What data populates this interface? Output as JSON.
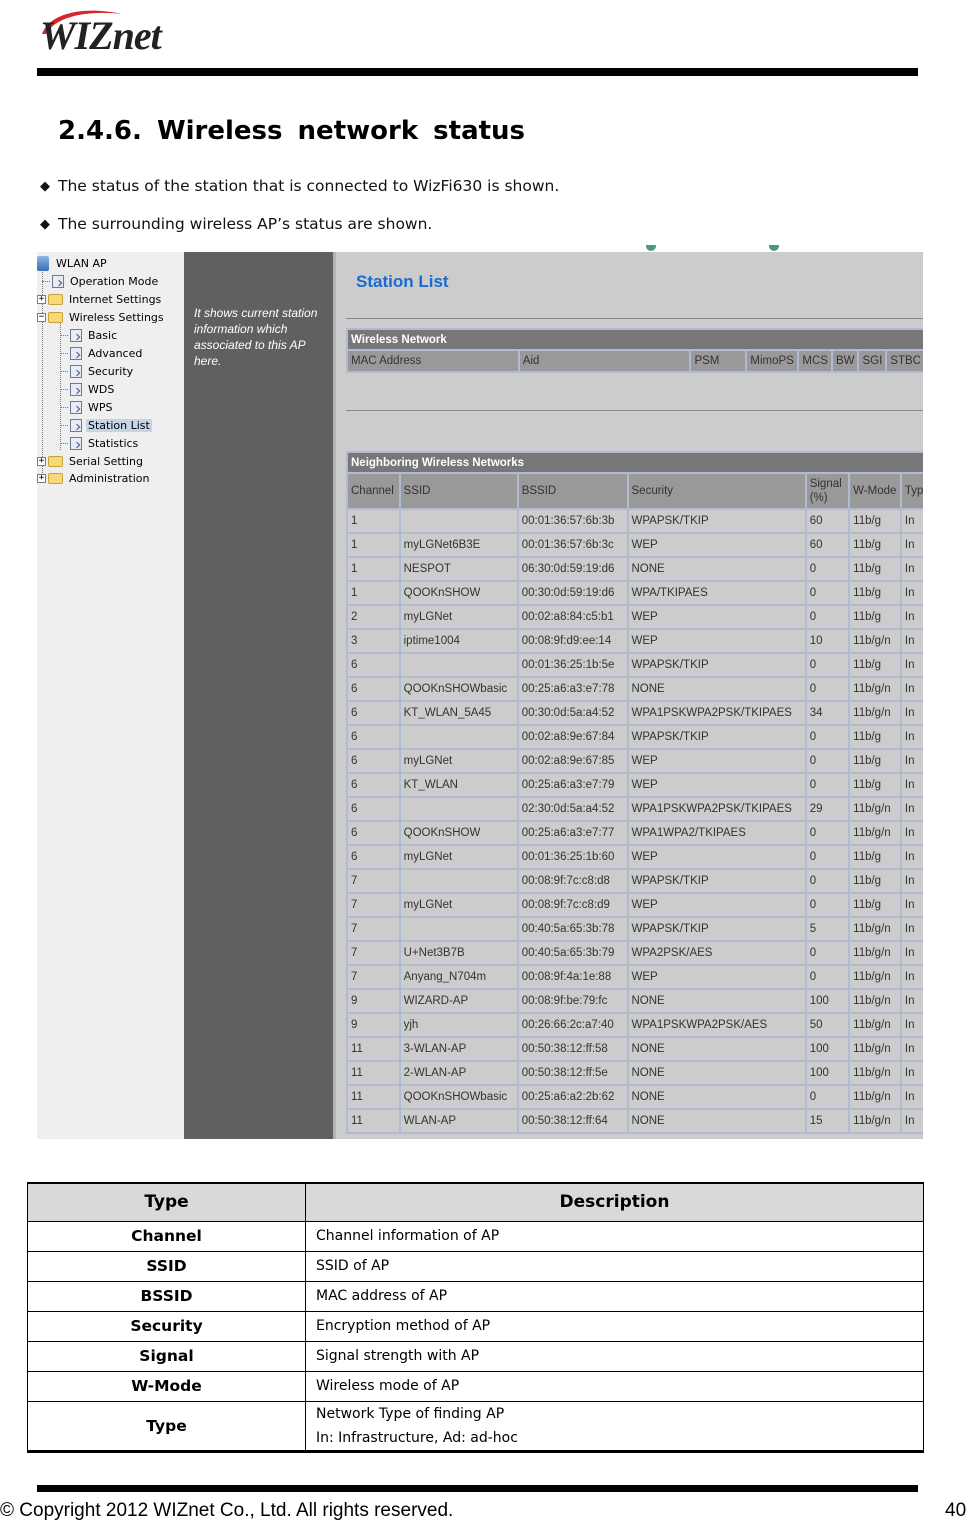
{
  "header": {
    "logo_text": "WIZnet",
    "heading": "2.4.6.  Wireless  network  status",
    "bullets": [
      "The status of the station that is connected to WizFi630 is shown.",
      "The surrounding wireless AP’s status are shown."
    ],
    "bullet_glyph": "◆"
  },
  "screenshot": {
    "tree": {
      "root": "WLAN AP",
      "items": [
        {
          "label": "Operation Mode",
          "type": "page"
        },
        {
          "label": "Internet Settings",
          "type": "folder",
          "state": "collapsed"
        },
        {
          "label": "Wireless Settings",
          "type": "folder",
          "state": "expanded"
        },
        {
          "label": "Basic",
          "type": "page"
        },
        {
          "label": "Advanced",
          "type": "page"
        },
        {
          "label": "Security",
          "type": "page"
        },
        {
          "label": "WDS",
          "type": "page"
        },
        {
          "label": "WPS",
          "type": "page"
        },
        {
          "label": "Station List",
          "type": "page",
          "selected": true
        },
        {
          "label": "Statistics",
          "type": "page"
        },
        {
          "label": "Serial Setting",
          "type": "folder",
          "state": "collapsed"
        },
        {
          "label": "Administration",
          "type": "folder",
          "state": "collapsed"
        }
      ]
    },
    "info_text": "It shows current station information which associated to this AP here.",
    "page_title": "Station List",
    "wireless_network": {
      "title": "Wireless Network",
      "columns": [
        "MAC Address",
        "Aid",
        "PSM",
        "MimoPS",
        "MCS",
        "BW",
        "SGI",
        "STBC"
      ]
    },
    "neighbors": {
      "title": "Neighboring Wireless Networks",
      "columns": [
        "Channel",
        "SSID",
        "BSSID",
        "Security",
        "Signal (%)",
        "W-Mode",
        "Type"
      ],
      "rows": [
        [
          "1",
          "",
          "00:01:36:57:6b:3b",
          "WPAPSK/TKIP",
          "60",
          "11b/g",
          "In"
        ],
        [
          "1",
          "myLGNet6B3E",
          "00:01:36:57:6b:3c",
          "WEP",
          "60",
          "11b/g",
          "In"
        ],
        [
          "1",
          "NESPOT",
          "06:30:0d:59:19:d6",
          "NONE",
          "0",
          "11b/g",
          "In"
        ],
        [
          "1",
          "QOOKnSHOW",
          "00:30:0d:59:19:d6",
          "WPA/TKIPAES",
          "0",
          "11b/g",
          "In"
        ],
        [
          "2",
          "myLGNet",
          "00:02:a8:84:c5:b1",
          "WEP",
          "0",
          "11b/g",
          "In"
        ],
        [
          "3",
          "iptime1004",
          "00:08:9f:d9:ee:14",
          "WEP",
          "10",
          "11b/g/n",
          "In"
        ],
        [
          "6",
          "",
          "00:01:36:25:1b:5e",
          "WPAPSK/TKIP",
          "0",
          "11b/g",
          "In"
        ],
        [
          "6",
          "QOOKnSHOWbasic",
          "00:25:a6:a3:e7:78",
          "NONE",
          "0",
          "11b/g/n",
          "In"
        ],
        [
          "6",
          "KT_WLAN_5A45",
          "00:30:0d:5a:a4:52",
          "WPA1PSKWPA2PSK/TKIPAES",
          "34",
          "11b/g/n",
          "In"
        ],
        [
          "6",
          "",
          "00:02:a8:9e:67:84",
          "WPAPSK/TKIP",
          "0",
          "11b/g",
          "In"
        ],
        [
          "6",
          "myLGNet",
          "00:02:a8:9e:67:85",
          "WEP",
          "0",
          "11b/g",
          "In"
        ],
        [
          "6",
          "KT_WLAN",
          "00:25:a6:a3:e7:79",
          "WEP",
          "0",
          "11b/g",
          "In"
        ],
        [
          "6",
          "",
          "02:30:0d:5a:a4:52",
          "WPA1PSKWPA2PSK/TKIPAES",
          "29",
          "11b/g/n",
          "In"
        ],
        [
          "6",
          "QOOKnSHOW",
          "00:25:a6:a3:e7:77",
          "WPA1WPA2/TKIPAES",
          "0",
          "11b/g/n",
          "In"
        ],
        [
          "6",
          "myLGNet",
          "00:01:36:25:1b:60",
          "WEP",
          "0",
          "11b/g",
          "In"
        ],
        [
          "7",
          "",
          "00:08:9f:7c:c8:d8",
          "WPAPSK/TKIP",
          "0",
          "11b/g",
          "In"
        ],
        [
          "7",
          "myLGNet",
          "00:08:9f:7c:c8:d9",
          "WEP",
          "0",
          "11b/g",
          "In"
        ],
        [
          "7",
          "",
          "00:40:5a:65:3b:78",
          "WPAPSK/TKIP",
          "5",
          "11b/g/n",
          "In"
        ],
        [
          "7",
          "U+Net3B7B",
          "00:40:5a:65:3b:79",
          "WPA2PSK/AES",
          "0",
          "11b/g/n",
          "In"
        ],
        [
          "7",
          "Anyang_N704m",
          "00:08:9f:4a:1e:88",
          "WEP",
          "0",
          "11b/g/n",
          "In"
        ],
        [
          "9",
          "WIZARD-AP",
          "00:08:9f:be:79:fc",
          "NONE",
          "100",
          "11b/g/n",
          "In"
        ],
        [
          "9",
          "yjh",
          "00:26:66:2c:a7:40",
          "WPA1PSKWPA2PSK/AES",
          "50",
          "11b/g/n",
          "In"
        ],
        [
          "11",
          "3-WLAN-AP",
          "00:50:38:12:ff:58",
          "NONE",
          "100",
          "11b/g/n",
          "In"
        ],
        [
          "11",
          "2-WLAN-AP",
          "00:50:38:12:ff:5e",
          "NONE",
          "100",
          "11b/g/n",
          "In"
        ],
        [
          "11",
          "QOOKnSHOWbasic",
          "00:25:a6:a2:2b:62",
          "NONE",
          "0",
          "11b/g/n",
          "In"
        ],
        [
          "11",
          "WLAN-AP",
          "00:50:38:12:ff:64",
          "NONE",
          "15",
          "11b/g/n",
          "In"
        ]
      ]
    }
  },
  "description_table": {
    "headers": [
      "Type",
      "Description"
    ],
    "rows": [
      {
        "type": "Channel",
        "desc": [
          "Channel information of AP"
        ]
      },
      {
        "type": "SSID",
        "desc": [
          "SSID of AP"
        ]
      },
      {
        "type": "BSSID",
        "desc": [
          "MAC address of AP"
        ]
      },
      {
        "type": "Security",
        "desc": [
          "Encryption method of AP"
        ]
      },
      {
        "type": "Signal",
        "desc": [
          "Signal strength with AP"
        ]
      },
      {
        "type": "W-Mode",
        "desc": [
          "Wireless mode of AP"
        ]
      },
      {
        "type": "Type",
        "desc": [
          "Network Type of finding AP",
          "In: Infrastructure, Ad: ad-hoc"
        ]
      }
    ]
  },
  "footer": {
    "copyright": "© Copyright 2012 WIZnet Co., Ltd. All rights reserved.",
    "page_number": "40"
  }
}
